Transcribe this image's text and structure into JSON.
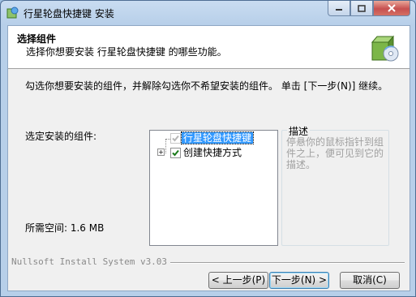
{
  "window": {
    "title": "行星轮盘快捷键 安装",
    "controls": {
      "minimize": "minimize-icon",
      "maximize": "maximize-icon",
      "close": "close-icon"
    }
  },
  "header": {
    "title": "选择组件",
    "subtitle": "选择你想要安装 行星轮盘快捷键 的哪些功能。"
  },
  "main": {
    "instructions": "勾选你想要安装的组件，并解除勾选你不希望安装的组件。 单击 [下一步(N)] 继续。",
    "components_label": "选定安装的组件:",
    "space_label": "所需空间: 1.6 MB",
    "tree": [
      {
        "label": "行星轮盘快捷键",
        "checked": true,
        "disabled": true,
        "selected": true
      },
      {
        "label": "创建快捷方式",
        "checked": true,
        "disabled": false,
        "expandable": true
      }
    ],
    "description": {
      "legend": "描述",
      "text": "停悬你的鼠标指针到组件之上，便可见到它的描述。"
    }
  },
  "footer": {
    "brand": "Nullsoft Install System v3.03",
    "back_label": "< 上一步(P)",
    "next_label": "下一步(N) >",
    "cancel_label": "取消(C)"
  },
  "colors": {
    "selection": "#3399ff",
    "check": "#1a7a1a",
    "disabled_text": "#a0a0a0"
  }
}
